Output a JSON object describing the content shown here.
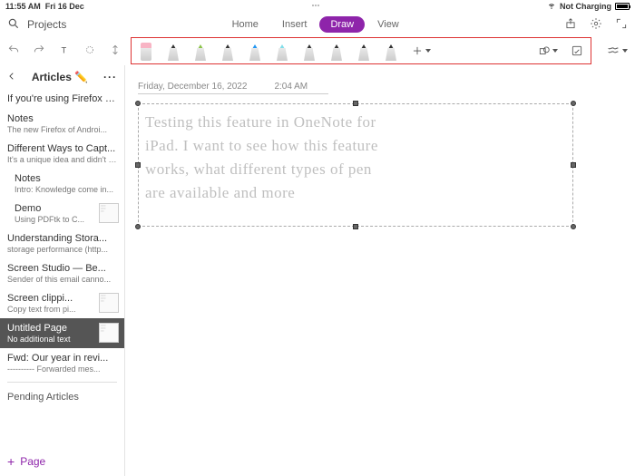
{
  "status": {
    "time": "11:55 AM",
    "date": "Fri 16 Dec",
    "charge": "Not Charging"
  },
  "search_label": "Projects",
  "tabs": {
    "home": "Home",
    "insert": "Insert",
    "draw": "Draw",
    "view": "View"
  },
  "sidebar": {
    "title": "Articles ✏️",
    "items": [
      {
        "t": "If you're using Firefox for And...",
        "s": ""
      },
      {
        "t": "Notes",
        "s": "The new Firefox of Androi..."
      },
      {
        "t": "Different Ways to Capt...",
        "s": "It's a unique idea and didn't fi..."
      },
      {
        "t": "Notes",
        "s": "Intro:  Knowledge come in..."
      },
      {
        "t": "Demo",
        "s": "Using PDFtk to C..."
      },
      {
        "t": "Understanding Stora...",
        "s": "storage performance  (http..."
      },
      {
        "t": "Screen Studio — Be...",
        "s": "Sender of this email canno..."
      },
      {
        "t": "Screen clippi...",
        "s": "Copy text from pi..."
      },
      {
        "t": "Untitled Page",
        "s": "No additional text"
      },
      {
        "t": "Fwd: Our year in revi...",
        "s": "---------- Forwarded mes..."
      }
    ],
    "pending": "Pending Articles",
    "add": "Page"
  },
  "note": {
    "date": "Friday, December 16, 2022",
    "time": "2:04 AM",
    "ink_lines": [
      "Testing this feature in OneNote for",
      "iPad.   I want to see how this feature",
      "works, what different types of pen",
      "are available and more"
    ]
  },
  "pen_colors": [
    "#ffffff",
    "#333333",
    "#8bc34a",
    "#333333",
    "#2196f3",
    "#80deea",
    "#333333",
    "#333333",
    "#333333",
    "#333333"
  ]
}
